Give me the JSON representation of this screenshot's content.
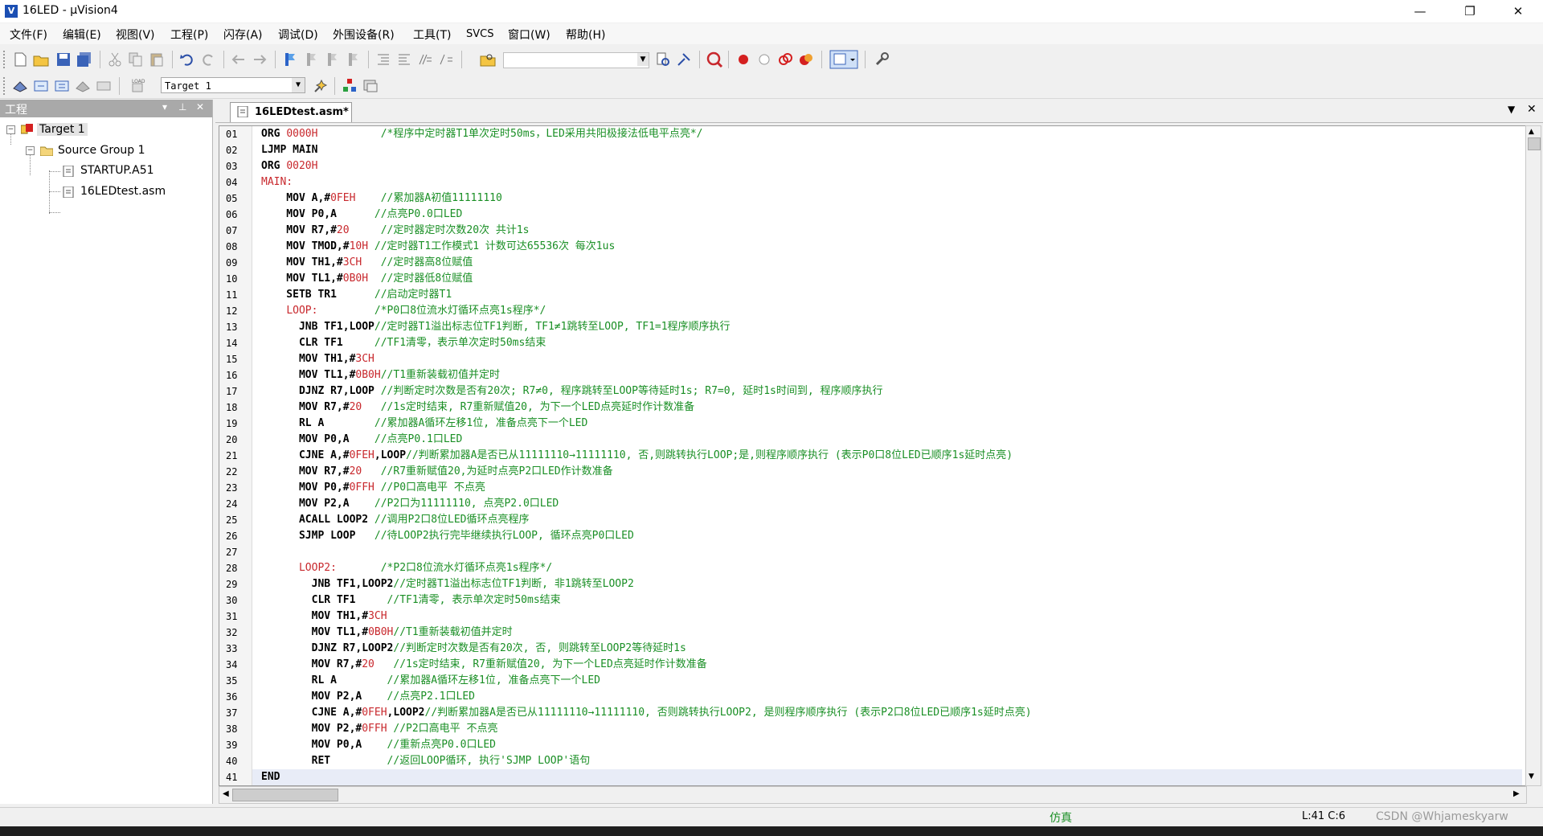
{
  "window": {
    "title": "16LED  - µVision4",
    "icon_letter": "V",
    "controls": {
      "minimize": "—",
      "maximize": "❐",
      "close": "✕"
    }
  },
  "menu": [
    "文件(F)",
    "编辑(E)",
    "视图(V)",
    "工程(P)",
    "闪存(A)",
    "调试(D)",
    "外围设备(R)",
    "工具(T)",
    "SVCS",
    "窗口(W)",
    "帮助(H)"
  ],
  "toolbar2": {
    "target": "Target 1"
  },
  "project": {
    "title": "工程",
    "tree": {
      "target": "Target 1",
      "group": "Source Group 1",
      "files": [
        "STARTUP.A51",
        "16LEDtest.asm"
      ]
    }
  },
  "editor": {
    "tab": "16LEDtest.asm*",
    "lines": [
      [
        {
          "t": "ORG ",
          "c": "code"
        },
        {
          "t": "0000H",
          "c": "num"
        },
        {
          "t": "          ",
          "c": "code"
        },
        {
          "t": "/*程序中定时器T1单次定时50ms，LED采用共阳极接法低电平点亮*/",
          "c": "cmt"
        }
      ],
      [
        {
          "t": "LJMP MAIN",
          "c": "code"
        }
      ],
      [
        {
          "t": "ORG ",
          "c": "code"
        },
        {
          "t": "0020H",
          "c": "num"
        }
      ],
      [
        {
          "t": "MAIN:",
          "c": "label"
        }
      ],
      [
        {
          "t": "    MOV A,#",
          "c": "code"
        },
        {
          "t": "0FEH",
          "c": "num"
        },
        {
          "t": "    ",
          "c": "code"
        },
        {
          "t": "//累加器A初值11111110",
          "c": "cmt"
        }
      ],
      [
        {
          "t": "    MOV P0,A      ",
          "c": "code"
        },
        {
          "t": "//点亮P0.0口LED",
          "c": "cmt"
        }
      ],
      [
        {
          "t": "    MOV R7,#",
          "c": "code"
        },
        {
          "t": "20",
          "c": "num"
        },
        {
          "t": "     ",
          "c": "code"
        },
        {
          "t": "//定时器定时次数20次 共计1s",
          "c": "cmt"
        }
      ],
      [
        {
          "t": "    MOV TMOD,#",
          "c": "code"
        },
        {
          "t": "10H",
          "c": "num"
        },
        {
          "t": " ",
          "c": "code"
        },
        {
          "t": "//定时器T1工作模式1 计数可达65536次 每次1us",
          "c": "cmt"
        }
      ],
      [
        {
          "t": "    MOV TH1,#",
          "c": "code"
        },
        {
          "t": "3CH",
          "c": "num"
        },
        {
          "t": "   ",
          "c": "code"
        },
        {
          "t": "//定时器高8位赋值",
          "c": "cmt"
        }
      ],
      [
        {
          "t": "    MOV TL1,#",
          "c": "code"
        },
        {
          "t": "0B0H",
          "c": "num"
        },
        {
          "t": "  ",
          "c": "code"
        },
        {
          "t": "//定时器低8位赋值",
          "c": "cmt"
        }
      ],
      [
        {
          "t": "    SETB TR1      ",
          "c": "code"
        },
        {
          "t": "//启动定时器T1",
          "c": "cmt"
        }
      ],
      [
        {
          "t": "    ",
          "c": "code"
        },
        {
          "t": "LOOP:",
          "c": "label"
        },
        {
          "t": "         ",
          "c": "code"
        },
        {
          "t": "/*P0口8位流水灯循环点亮1s程序*/",
          "c": "cmt"
        }
      ],
      [
        {
          "t": "      JNB TF1,LOOP",
          "c": "code"
        },
        {
          "t": "//定时器T1溢出标志位TF1判断, TF1≠1跳转至LOOP, TF1=1程序顺序执行",
          "c": "cmt"
        }
      ],
      [
        {
          "t": "      CLR TF1     ",
          "c": "code"
        },
        {
          "t": "//TF1清零，表示单次定时50ms结束",
          "c": "cmt"
        }
      ],
      [
        {
          "t": "      MOV TH1,#",
          "c": "code"
        },
        {
          "t": "3CH",
          "c": "num"
        }
      ],
      [
        {
          "t": "      MOV TL1,#",
          "c": "code"
        },
        {
          "t": "0B0H",
          "c": "num"
        },
        {
          "t": "//T1重新装载初值并定时",
          "c": "cmt"
        }
      ],
      [
        {
          "t": "      DJNZ R7,LOOP ",
          "c": "code"
        },
        {
          "t": "//判断定时次数是否有20次; R7≠0, 程序跳转至LOOP等待延时1s; R7=0, 延时1s时间到, 程序顺序执行",
          "c": "cmt"
        }
      ],
      [
        {
          "t": "      MOV R7,#",
          "c": "code"
        },
        {
          "t": "20",
          "c": "num"
        },
        {
          "t": "   ",
          "c": "code"
        },
        {
          "t": "//1s定时结束, R7重新赋值20, 为下一个LED点亮延时作计数准备",
          "c": "cmt"
        }
      ],
      [
        {
          "t": "      RL A        ",
          "c": "code"
        },
        {
          "t": "//累加器A循环左移1位, 准备点亮下一个LED",
          "c": "cmt"
        }
      ],
      [
        {
          "t": "      MOV P0,A    ",
          "c": "code"
        },
        {
          "t": "//点亮P0.1口LED",
          "c": "cmt"
        }
      ],
      [
        {
          "t": "      CJNE A,#",
          "c": "code"
        },
        {
          "t": "0FEH",
          "c": "num"
        },
        {
          "t": ",LOOP",
          "c": "code"
        },
        {
          "t": "//判断累加器A是否已从11111110→11111110, 否,则跳转执行LOOP;是,则程序顺序执行 (表示P0口8位LED已顺序1s延时点亮)",
          "c": "cmt"
        }
      ],
      [
        {
          "t": "      MOV R7,#",
          "c": "code"
        },
        {
          "t": "20",
          "c": "num"
        },
        {
          "t": "   ",
          "c": "code"
        },
        {
          "t": "//R7重新赋值20,为延时点亮P2口LED作计数准备",
          "c": "cmt"
        }
      ],
      [
        {
          "t": "      MOV P0,#",
          "c": "code"
        },
        {
          "t": "0FFH",
          "c": "num"
        },
        {
          "t": " ",
          "c": "code"
        },
        {
          "t": "//P0口高电平 不点亮",
          "c": "cmt"
        }
      ],
      [
        {
          "t": "      MOV P2,A    ",
          "c": "code"
        },
        {
          "t": "//P2口为11111110, 点亮P2.0口LED",
          "c": "cmt"
        }
      ],
      [
        {
          "t": "      ACALL LOOP2 ",
          "c": "code"
        },
        {
          "t": "//调用P2口8位LED循环点亮程序",
          "c": "cmt"
        }
      ],
      [
        {
          "t": "      SJMP LOOP   ",
          "c": "code"
        },
        {
          "t": "//待LOOP2执行完毕继续执行LOOP, 循环点亮P0口LED",
          "c": "cmt"
        }
      ],
      [],
      [
        {
          "t": "      ",
          "c": "code"
        },
        {
          "t": "LOOP2:",
          "c": "label"
        },
        {
          "t": "       ",
          "c": "code"
        },
        {
          "t": "/*P2口8位流水灯循环点亮1s程序*/",
          "c": "cmt"
        }
      ],
      [
        {
          "t": "        JNB TF1,LOOP2",
          "c": "code"
        },
        {
          "t": "//定时器T1溢出标志位TF1判断, 非1跳转至LOOP2",
          "c": "cmt"
        }
      ],
      [
        {
          "t": "        CLR TF1     ",
          "c": "code"
        },
        {
          "t": "//TF1清零, 表示单次定时50ms结束",
          "c": "cmt"
        }
      ],
      [
        {
          "t": "        MOV TH1,#",
          "c": "code"
        },
        {
          "t": "3CH",
          "c": "num"
        }
      ],
      [
        {
          "t": "        MOV TL1,#",
          "c": "code"
        },
        {
          "t": "0B0H",
          "c": "num"
        },
        {
          "t": "//T1重新装载初值并定时",
          "c": "cmt"
        }
      ],
      [
        {
          "t": "        DJNZ R7,LOOP2",
          "c": "code"
        },
        {
          "t": "//判断定时次数是否有20次, 否, 则跳转至LOOP2等待延时1s",
          "c": "cmt"
        }
      ],
      [
        {
          "t": "        MOV R7,#",
          "c": "code"
        },
        {
          "t": "20",
          "c": "num"
        },
        {
          "t": "   ",
          "c": "code"
        },
        {
          "t": "//1s定时结束, R7重新赋值20, 为下一个LED点亮延时作计数准备",
          "c": "cmt"
        }
      ],
      [
        {
          "t": "        RL A        ",
          "c": "code"
        },
        {
          "t": "//累加器A循环左移1位, 准备点亮下一个LED",
          "c": "cmt"
        }
      ],
      [
        {
          "t": "        MOV P2,A    ",
          "c": "code"
        },
        {
          "t": "//点亮P2.1口LED",
          "c": "cmt"
        }
      ],
      [
        {
          "t": "        CJNE A,#",
          "c": "code"
        },
        {
          "t": "0FEH",
          "c": "num"
        },
        {
          "t": ",LOOP2",
          "c": "code"
        },
        {
          "t": "//判断累加器A是否已从11111110→11111110, 否则跳转执行LOOP2, 是则程序顺序执行 (表示P2口8位LED已顺序1s延时点亮)",
          "c": "cmt"
        }
      ],
      [
        {
          "t": "        MOV P2,#",
          "c": "code"
        },
        {
          "t": "0FFH",
          "c": "num"
        },
        {
          "t": " ",
          "c": "code"
        },
        {
          "t": "//P2口高电平 不点亮",
          "c": "cmt"
        }
      ],
      [
        {
          "t": "        MOV P0,A    ",
          "c": "code"
        },
        {
          "t": "//重新点亮P0.0口LED",
          "c": "cmt"
        }
      ],
      [
        {
          "t": "        RET         ",
          "c": "code"
        },
        {
          "t": "//返回LOOP循环, 执行'SJMP LOOP'语句",
          "c": "cmt"
        }
      ],
      [
        {
          "t": "END",
          "c": "code"
        }
      ]
    ]
  },
  "status": {
    "mode": "仿真",
    "position": "L:41 C:6",
    "watermark": "CSDN @Whjameskyarw"
  },
  "colors": {
    "code": "#000000",
    "number": "#c8282d",
    "comment": "#1a8f25"
  }
}
